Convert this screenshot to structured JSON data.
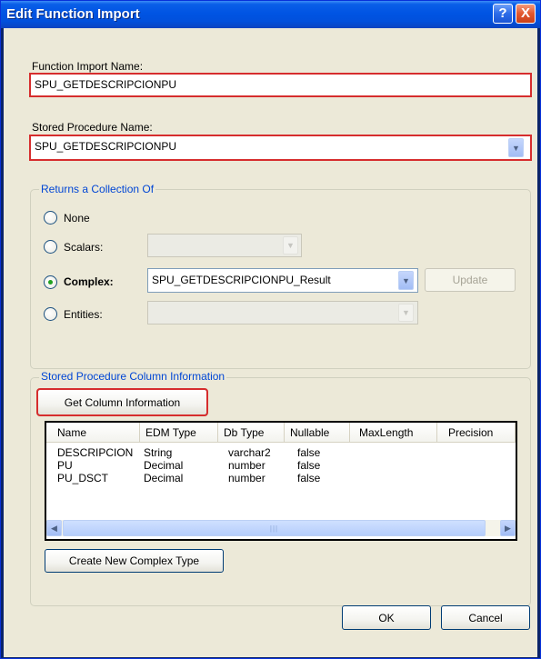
{
  "window": {
    "title": "Edit Function Import",
    "help_label": "?",
    "close_label": "X"
  },
  "function_import": {
    "label": "Function Import Name:",
    "value": "SPU_GETDESCRIPCIONPU"
  },
  "stored_procedure": {
    "label": "Stored Procedure Name:",
    "value": "SPU_GETDESCRIPCIONPU"
  },
  "returns": {
    "legend": "Returns a Collection Of",
    "none_label": "None",
    "scalars_label": "Scalars:",
    "complex_label": "Complex:",
    "complex_value": "SPU_GETDESCRIPCIONPU_Result",
    "entities_label": "Entities:",
    "update_label": "Update",
    "selected": "Complex"
  },
  "column_info": {
    "legend": "Stored Procedure Column Information",
    "get_button": "Get Column Information",
    "headers": [
      "Name",
      "EDM Type",
      "Db Type",
      "Nullable",
      "MaxLength",
      "Precision"
    ],
    "rows": [
      [
        "DESCRIPCION",
        "String",
        "varchar2",
        "false",
        "",
        ""
      ],
      [
        "PU",
        "Decimal",
        "number",
        "false",
        "",
        ""
      ],
      [
        "PU_DSCT",
        "Decimal",
        "number",
        "false",
        "",
        ""
      ]
    ],
    "create_button": "Create New Complex Type"
  },
  "footer": {
    "ok_label": "OK",
    "cancel_label": "Cancel"
  }
}
